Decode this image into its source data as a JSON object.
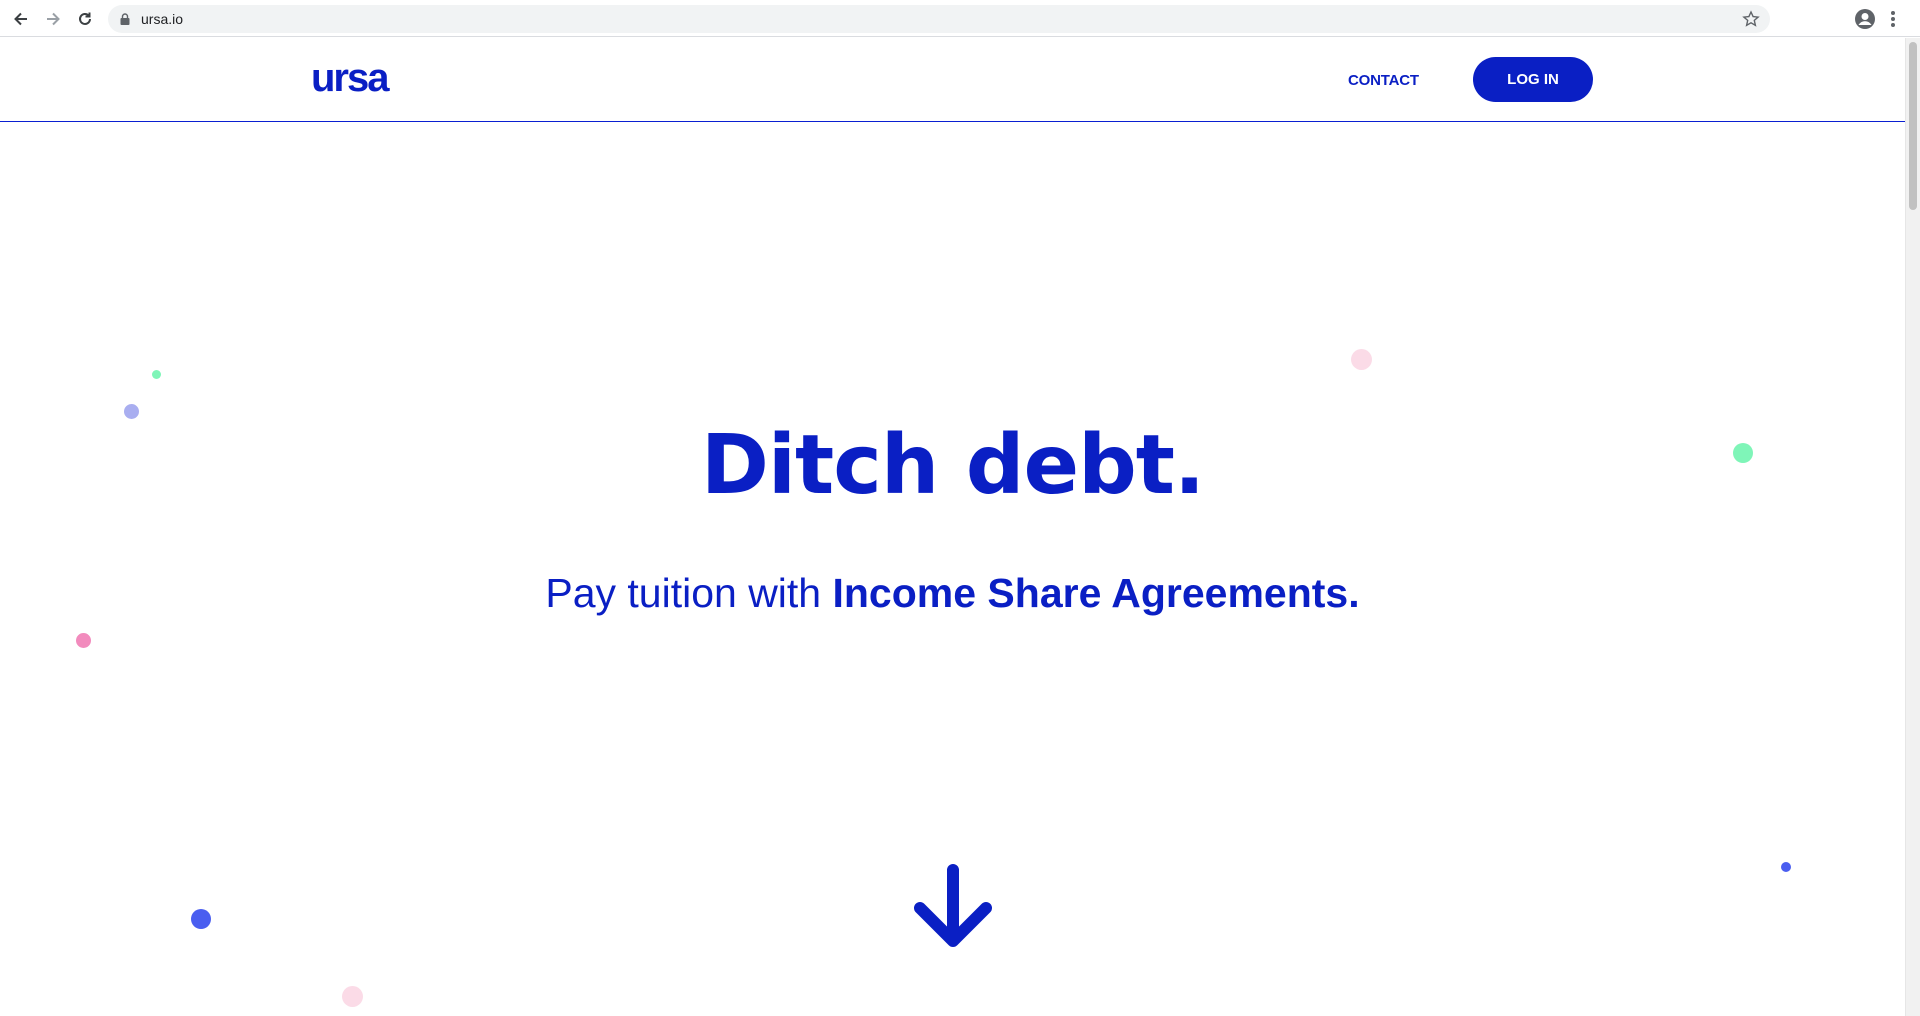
{
  "browser": {
    "url": "ursa.io"
  },
  "header": {
    "logo": "ursa",
    "contact_label": "CONTACT",
    "login_label": "LOG IN"
  },
  "hero": {
    "title": "Ditch debt.",
    "subtitle_prefix": "Pay tuition with ",
    "subtitle_emphasis": "Income Share Agreements."
  },
  "colors": {
    "brand": "#0a1fc4",
    "dot_green": "#7ff5b8",
    "dot_lavender": "#a9aef0",
    "dot_pink": "#f28bbd",
    "dot_pale_pink": "#fbdbe7",
    "dot_blue": "#4a5ef0"
  }
}
